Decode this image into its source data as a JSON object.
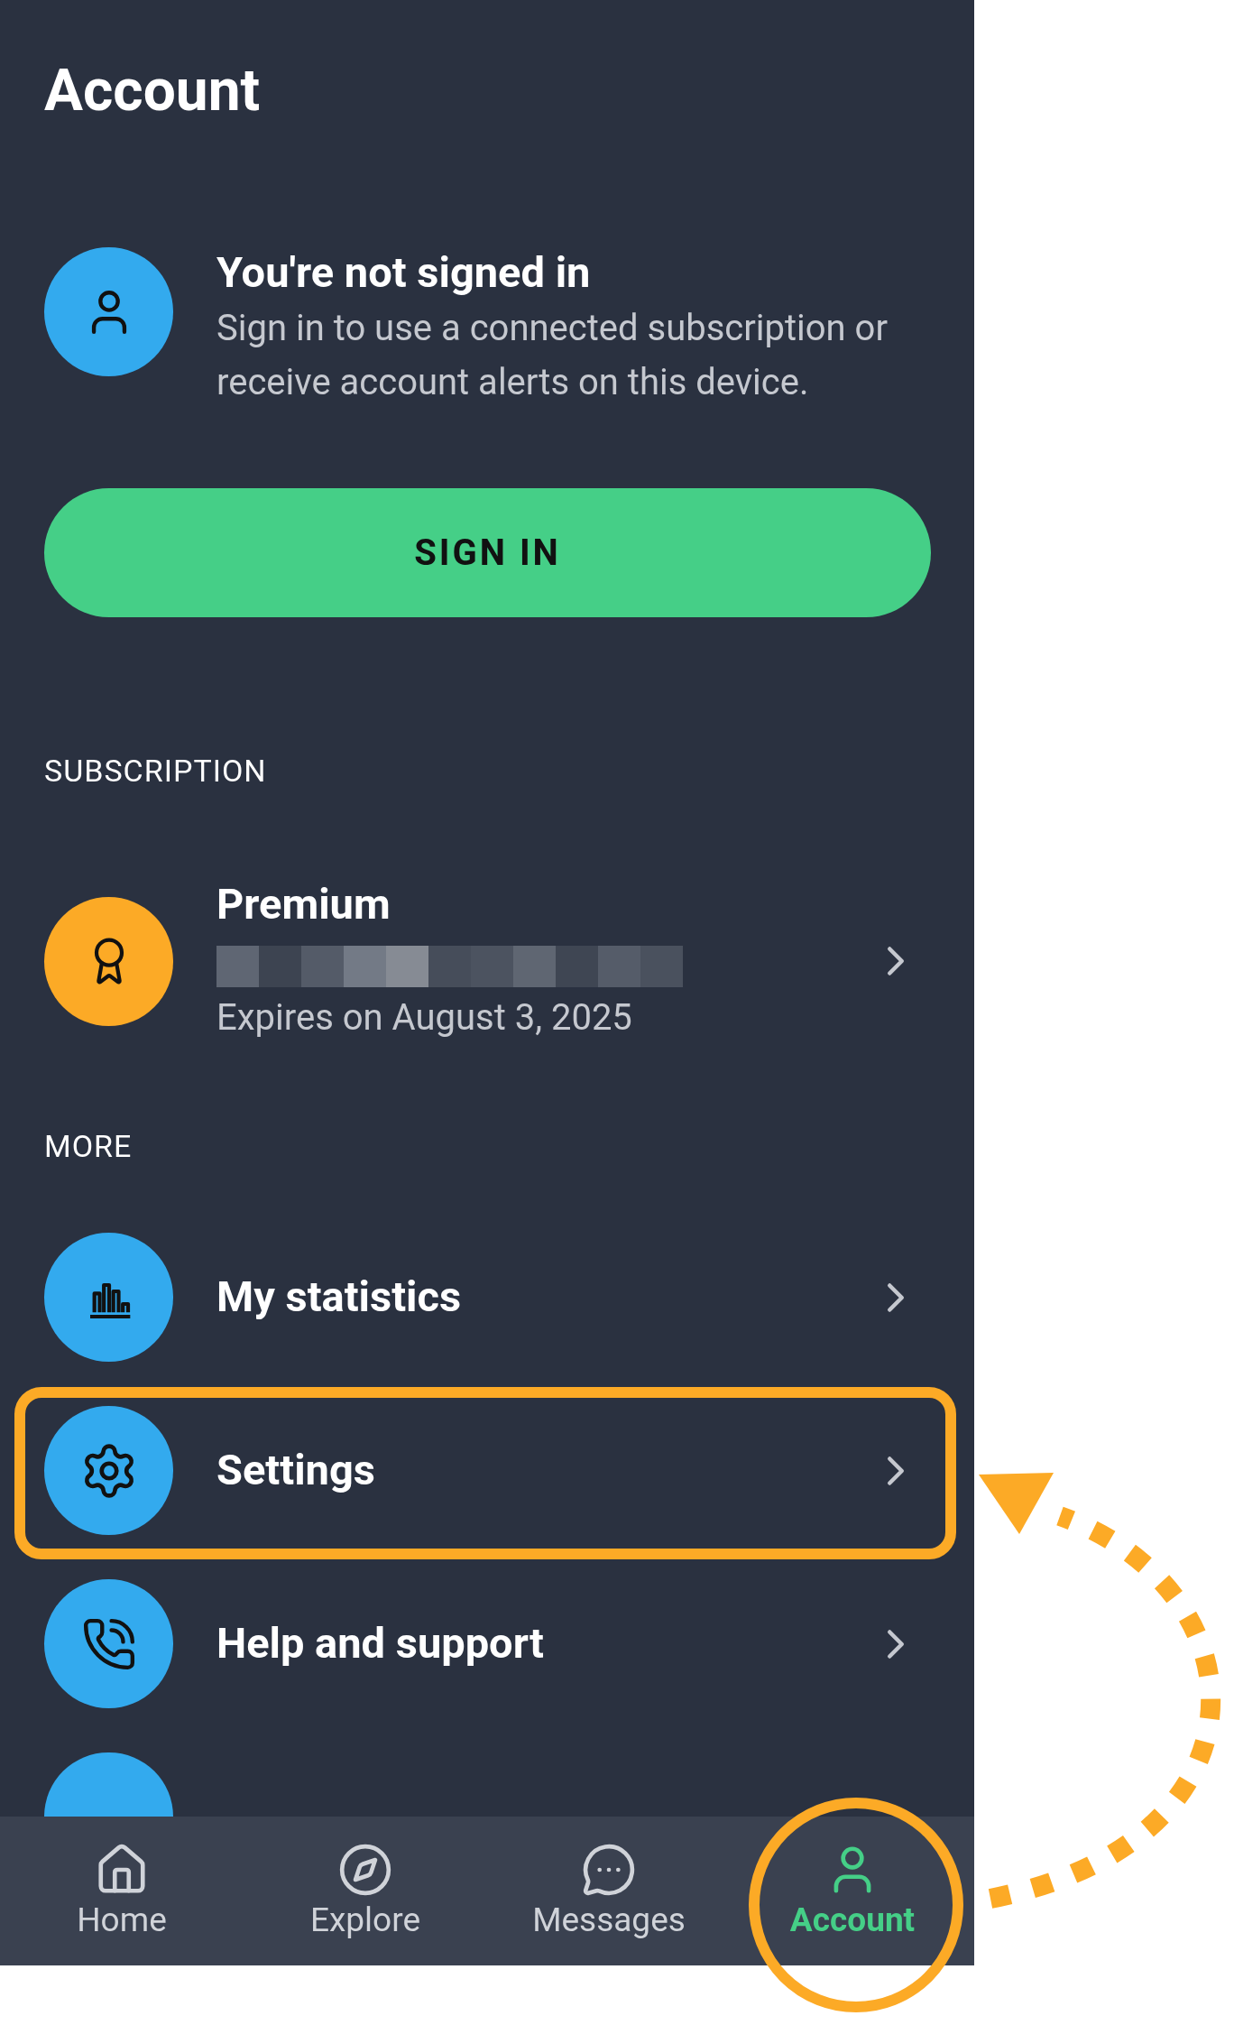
{
  "header": {
    "title": "Account"
  },
  "profile": {
    "title": "You're not signed in",
    "description": "Sign in to use a connected subscription or receive account alerts on this device."
  },
  "sign_in_button": {
    "label": "SIGN IN"
  },
  "subscription": {
    "heading": "SUBSCRIPTION",
    "item": {
      "title": "Premium",
      "subtitle": "Expires on August 3, 2025"
    }
  },
  "more": {
    "heading": "MORE",
    "items": [
      {
        "label": "My statistics"
      },
      {
        "label": "Settings"
      },
      {
        "label": "Help and support"
      }
    ]
  },
  "bottom_nav": [
    {
      "label": "Home",
      "selected": false
    },
    {
      "label": "Explore",
      "selected": false
    },
    {
      "label": "Messages",
      "selected": false
    },
    {
      "label": "Account",
      "selected": true
    }
  ]
}
